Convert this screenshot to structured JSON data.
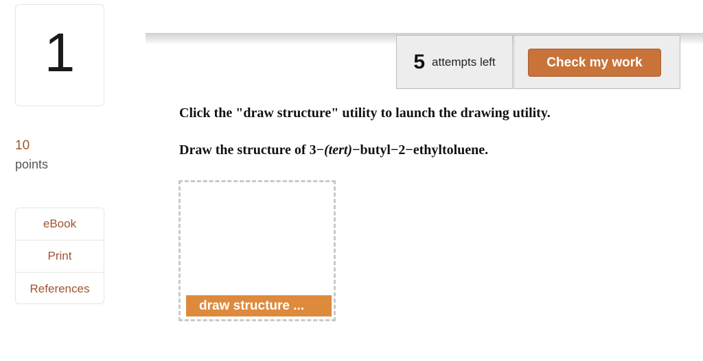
{
  "question": {
    "number": "1",
    "points_value": "10",
    "points_label": "points"
  },
  "resources": {
    "items": [
      "eBook",
      "Print",
      "References"
    ]
  },
  "attempts": {
    "count": "5",
    "label": "attempts left"
  },
  "check_button": {
    "label": "Check my work"
  },
  "instructions": {
    "line1": "Click the \"draw structure\" utility to launch the drawing utility.",
    "line2_prefix": "Draw the structure of 3−",
    "line2_italic": "(tert)",
    "line2_suffix": "−butyl−2−ethyltoluene."
  },
  "draw_button": {
    "label": "draw structure ..."
  },
  "colors": {
    "accent": "#c7733a",
    "draw_button": "#de8a3c",
    "link": "#a0522d"
  }
}
